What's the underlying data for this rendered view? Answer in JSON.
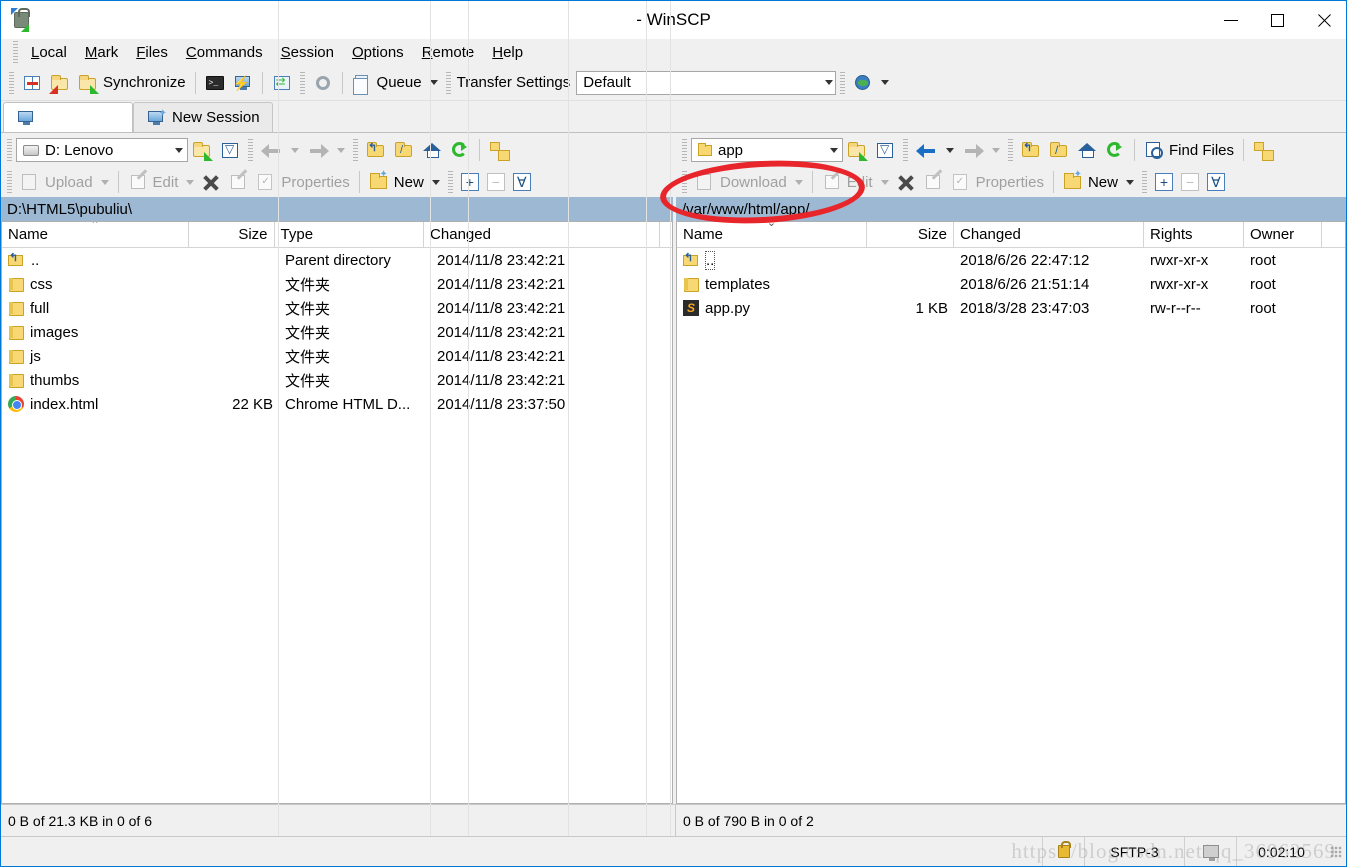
{
  "window": {
    "title": "- WinSCP",
    "icon": "winscp-lock-icon",
    "minimize_label": "Minimize",
    "maximize_label": "Maximize",
    "close_label": "Close"
  },
  "menu": {
    "items": [
      {
        "label": "Local",
        "accel": "L"
      },
      {
        "label": "Mark",
        "accel": "M"
      },
      {
        "label": "Files",
        "accel": "F"
      },
      {
        "label": "Commands",
        "accel": "C"
      },
      {
        "label": "Session",
        "accel": "S"
      },
      {
        "label": "Options",
        "accel": "O"
      },
      {
        "label": "Remote",
        "accel": "R"
      },
      {
        "label": "Help",
        "accel": "H"
      }
    ]
  },
  "toolbar": {
    "synchronize_label": "Synchronize",
    "queue_label": "Queue",
    "transfer_settings_label": "Transfer Settings",
    "transfer_settings_value": "Default",
    "icons": [
      "synchronize-browsing-icon",
      "synchronize-up-icon",
      "synchronize-down-icon",
      "open-console-icon",
      "open-terminal-icon",
      "compare-icon",
      "preferences-gear-icon",
      "queue-icon",
      "globe-icon"
    ]
  },
  "tabs": {
    "active": {
      "label": "",
      "icon": "session-monitor-icon"
    },
    "new_session": {
      "label": "New Session",
      "icon": "new-session-icon"
    }
  },
  "left_panel": {
    "drive_value": "D: Lenovo",
    "path": "D:\\HTML5\\pubuliu\\",
    "ops": {
      "upload": "Upload",
      "edit": "Edit",
      "delete": "",
      "rename": "",
      "properties": "Properties",
      "new": "New"
    },
    "columns": [
      "Name",
      "Size",
      "Type",
      "Changed"
    ],
    "sort_column": "Name",
    "sort_direction": "asc",
    "rows": [
      {
        "name": "..",
        "icon": "parent-directory-icon",
        "size": "",
        "type": "Parent directory",
        "changed": "2014/11/8  23:42:21"
      },
      {
        "name": "css",
        "icon": "folder-icon",
        "size": "",
        "type": "文件夹",
        "changed": "2014/11/8  23:42:21"
      },
      {
        "name": "full",
        "icon": "folder-icon",
        "size": "",
        "type": "文件夹",
        "changed": "2014/11/8  23:42:21"
      },
      {
        "name": "images",
        "icon": "folder-icon",
        "size": "",
        "type": "文件夹",
        "changed": "2014/11/8  23:42:21"
      },
      {
        "name": "js",
        "icon": "folder-icon",
        "size": "",
        "type": "文件夹",
        "changed": "2014/11/8  23:42:21"
      },
      {
        "name": "thumbs",
        "icon": "folder-icon",
        "size": "",
        "type": "文件夹",
        "changed": "2014/11/8  23:42:21"
      },
      {
        "name": "index.html",
        "icon": "chrome-html-icon",
        "size": "22 KB",
        "type": "Chrome HTML D...",
        "changed": "2014/11/8  23:37:50"
      }
    ],
    "status": "0 B of 21.3 KB in 0 of 6"
  },
  "right_panel": {
    "dir_value": "app",
    "path": "/var/www/html/app/",
    "find_files_label": "Find Files",
    "ops": {
      "download": "Download",
      "edit": "Edit",
      "delete": "",
      "rename": "",
      "properties": "Properties",
      "new": "New"
    },
    "columns": [
      "Name",
      "Size",
      "Changed",
      "Rights",
      "Owner"
    ],
    "sort_column": "Name",
    "sort_direction": "desc",
    "rows": [
      {
        "name": "..",
        "icon": "parent-directory-icon",
        "size": "",
        "changed": "2018/6/26 22:47:12",
        "rights": "rwxr-xr-x",
        "owner": "root",
        "selected": true
      },
      {
        "name": "templates",
        "icon": "folder-icon",
        "size": "",
        "changed": "2018/6/26 21:51:14",
        "rights": "rwxr-xr-x",
        "owner": "root",
        "selected": false
      },
      {
        "name": "app.py",
        "icon": "python-file-icon",
        "size": "1 KB",
        "changed": "2018/3/28 23:47:03",
        "rights": "rw-r--r--",
        "owner": "root",
        "selected": false
      }
    ],
    "status": "0 B of 790 B in 0 of 2"
  },
  "statusbar": {
    "protocol": "SFTP-3",
    "duration": "0:02:10",
    "lock_icon": "secure-lock-icon",
    "network_icon": "network-monitor-icon"
  },
  "watermark": {
    "text": "https://blog.csdn.net/qq_36962569"
  },
  "annotation": {
    "type": "red-ellipse-highlight",
    "target": "remote-path-bar"
  },
  "colors": {
    "window_border": "#0078d7",
    "chrome_bg": "#f0f0f0",
    "pathbar_bg": "#9db8d2",
    "annotation_red": "#e8252a"
  }
}
